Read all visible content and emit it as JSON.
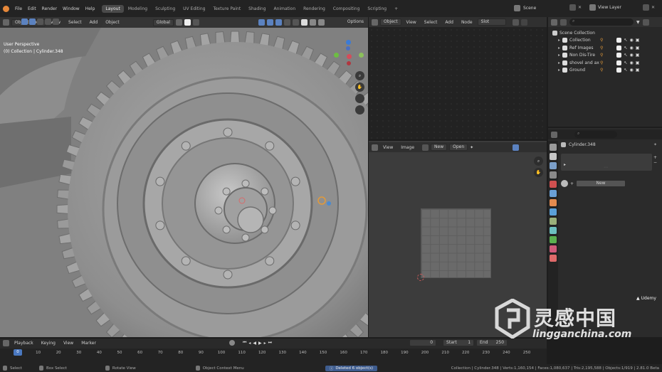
{
  "topbar": {
    "menus": [
      "File",
      "Edit",
      "Render",
      "Window",
      "Help"
    ],
    "workspaces": [
      "Layout",
      "Modeling",
      "Sculpting",
      "UV Editing",
      "Texture Paint",
      "Shading",
      "Animation",
      "Rendering",
      "Compositing",
      "Scripting"
    ],
    "active_workspace": "Layout",
    "add_tab": "+",
    "scene_label": "Scene",
    "view_layer_label": "View Layer"
  },
  "viewport": {
    "mode": "Object Mode",
    "menus": [
      "View",
      "Select",
      "Add",
      "Object"
    ],
    "orientation": "Global",
    "options_label": "Options",
    "overlay_title": "User Perspective",
    "overlay_subtitle": "(0) Collection | Cylinder.348"
  },
  "node_editor": {
    "object_label": "Object",
    "menus": [
      "View",
      "Select",
      "Add",
      "Node"
    ],
    "slot_label": "Slot"
  },
  "image_editor": {
    "menus": [
      "View",
      "Image"
    ],
    "new_label": "New",
    "open_label": "Open"
  },
  "outliner": {
    "root": "Scene Collection",
    "items": [
      {
        "label": "Collection"
      },
      {
        "label": "Ref Images"
      },
      {
        "label": "Non Dis-Tire"
      },
      {
        "label": "shovel and ax"
      },
      {
        "label": "Ground"
      }
    ]
  },
  "properties": {
    "object_name": "Cylinder.348",
    "add_label": "+",
    "remove_label": "−",
    "new_label": "New",
    "tab_colors": [
      "#9a9a9a",
      "#c8c8c8",
      "#7b9fc9",
      "#8a8a8a",
      "#d05050",
      "#6aa0d6",
      "#e38b4f",
      "#5aa0d8",
      "#9ab07a",
      "#6cc0c0",
      "#5ab04f",
      "#d05a7a",
      "#e06a6a"
    ]
  },
  "timeline": {
    "menus": [
      "Playback",
      "Keying",
      "View",
      "Marker"
    ],
    "current_frame": "0",
    "start_label": "Start",
    "start_value": "1",
    "end_label": "End",
    "end_value": "250",
    "ticks": [
      "0",
      "10",
      "20",
      "30",
      "40",
      "50",
      "60",
      "70",
      "80",
      "90",
      "100",
      "110",
      "120",
      "130",
      "140",
      "150",
      "160",
      "170",
      "180",
      "190",
      "200",
      "210",
      "220",
      "230",
      "240",
      "250"
    ]
  },
  "statusbar": {
    "select": "Select",
    "box_select": "Box Select",
    "rotate_view": "Rotate View",
    "context_menu": "Object Context Menu",
    "message": "Deleted 6 object(s)",
    "stats": "Collection | Cylinder.348 | Verts:1,160,154 | Faces:1,080,637 | Tris:2,195,588 | Objects:1/919 | 2.81.0 Beta"
  },
  "watermark": {
    "brand": "Udemy",
    "cn_title": "灵感中国",
    "site": "lingganchina.com"
  }
}
